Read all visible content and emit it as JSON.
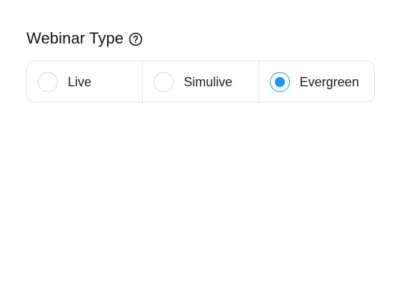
{
  "section": {
    "title": "Webinar Type",
    "help_icon": "question-circle-icon"
  },
  "options": [
    {
      "label": "Live",
      "selected": false
    },
    {
      "label": "Simulive",
      "selected": false
    },
    {
      "label": "Evergreen",
      "selected": true
    }
  ],
  "colors": {
    "accent": "#1a96f0",
    "border": "#e3e3e3",
    "radio_border": "#d4d4d4",
    "text": "#111111"
  }
}
